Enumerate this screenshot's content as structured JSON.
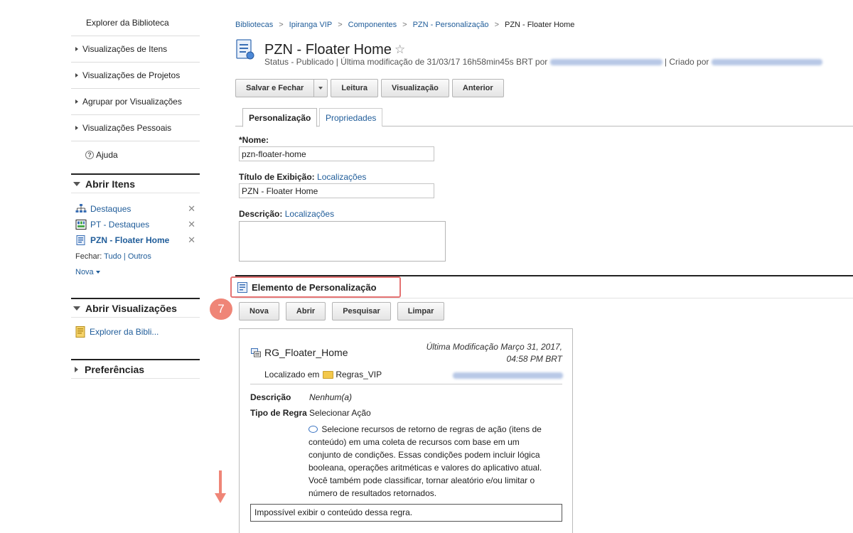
{
  "sidebar": {
    "top_items": [
      {
        "label": "Explorer da Biblioteca"
      },
      {
        "label": "Visualizações de Itens"
      },
      {
        "label": "Visualizações de Projetos"
      },
      {
        "label": "Agrupar por Visualizações"
      },
      {
        "label": "Visualizações Pessoais"
      },
      {
        "label": "Ajuda"
      }
    ],
    "open_items": {
      "heading": "Abrir Itens",
      "items": [
        {
          "label": "Destaques",
          "icon": "hierarchy-icon"
        },
        {
          "label": "PT - Destaques",
          "icon": "presentation-template-icon"
        },
        {
          "label": "PZN - Floater Home",
          "icon": "personalization-component-icon"
        }
      ],
      "close_label": "Fechar:",
      "close_all": "Tudo",
      "close_sep": "|",
      "close_others": "Outros",
      "new_label": "Nova"
    },
    "open_views": {
      "heading": "Abrir Visualizações",
      "items": [
        {
          "label": "Explorer da Bibli..."
        }
      ]
    },
    "preferences": {
      "heading": "Preferências"
    }
  },
  "breadcrumb": [
    "Bibliotecas",
    "Ipiranga VIP",
    "Componentes",
    "PZN - Personalização",
    "PZN - Floater Home"
  ],
  "breadcrumb_sep": ">",
  "page": {
    "title": "PZN - Floater Home",
    "status_text": "Status - Publicado | Última modificação de 31/03/17 16h58min45s BRT por",
    "created_by_label": "| Criado por"
  },
  "toolbar": {
    "save_close": "Salvar e Fechar",
    "read": "Leitura",
    "view": "Visualização",
    "previous": "Anterior"
  },
  "tabs": {
    "personalization": "Personalização",
    "properties": "Propriedades"
  },
  "form": {
    "name_label": "*Nome:",
    "name_value": "pzn-floater-home",
    "display_title_label": "Título de Exibição:",
    "display_title_link": "Localizações",
    "display_title_value": "PZN - Floater Home",
    "description_label": "Descrição:",
    "description_link": "Localizações",
    "description_value": ""
  },
  "section": {
    "title": "Elemento de Personalização",
    "step_number": "7",
    "buttons": {
      "new": "Nova",
      "open": "Abrir",
      "search": "Pesquisar",
      "clear": "Limpar"
    }
  },
  "rule": {
    "name": "RG_Floater_Home",
    "modified": "Última Modificação Março 31, 2017, 04:58 PM BRT",
    "located_label": "Localizado em",
    "folder": "Regras_VIP",
    "description_key": "Descrição",
    "description_value": "Nenhum(a)",
    "type_key": "Tipo de Regra",
    "type_value": "Selecionar Ação",
    "type_description": "Selecione recursos de retorno de regras de ação (itens de conteúdo) em uma coleta de recursos com base em um conjunto de condições. Essas condições podem incluir lógica booleana, operações aritméticas e valores do aplicativo atual. Você também pode classificar, tornar aleatório e/ou limitar o número de resultados retornados.",
    "message": "Impossível exibir o conteúdo dessa regra."
  },
  "colors": {
    "link": "#1f5c99",
    "highlight": "#e57373",
    "step_badge": "#ef8577",
    "arrow": "#ef8577"
  }
}
